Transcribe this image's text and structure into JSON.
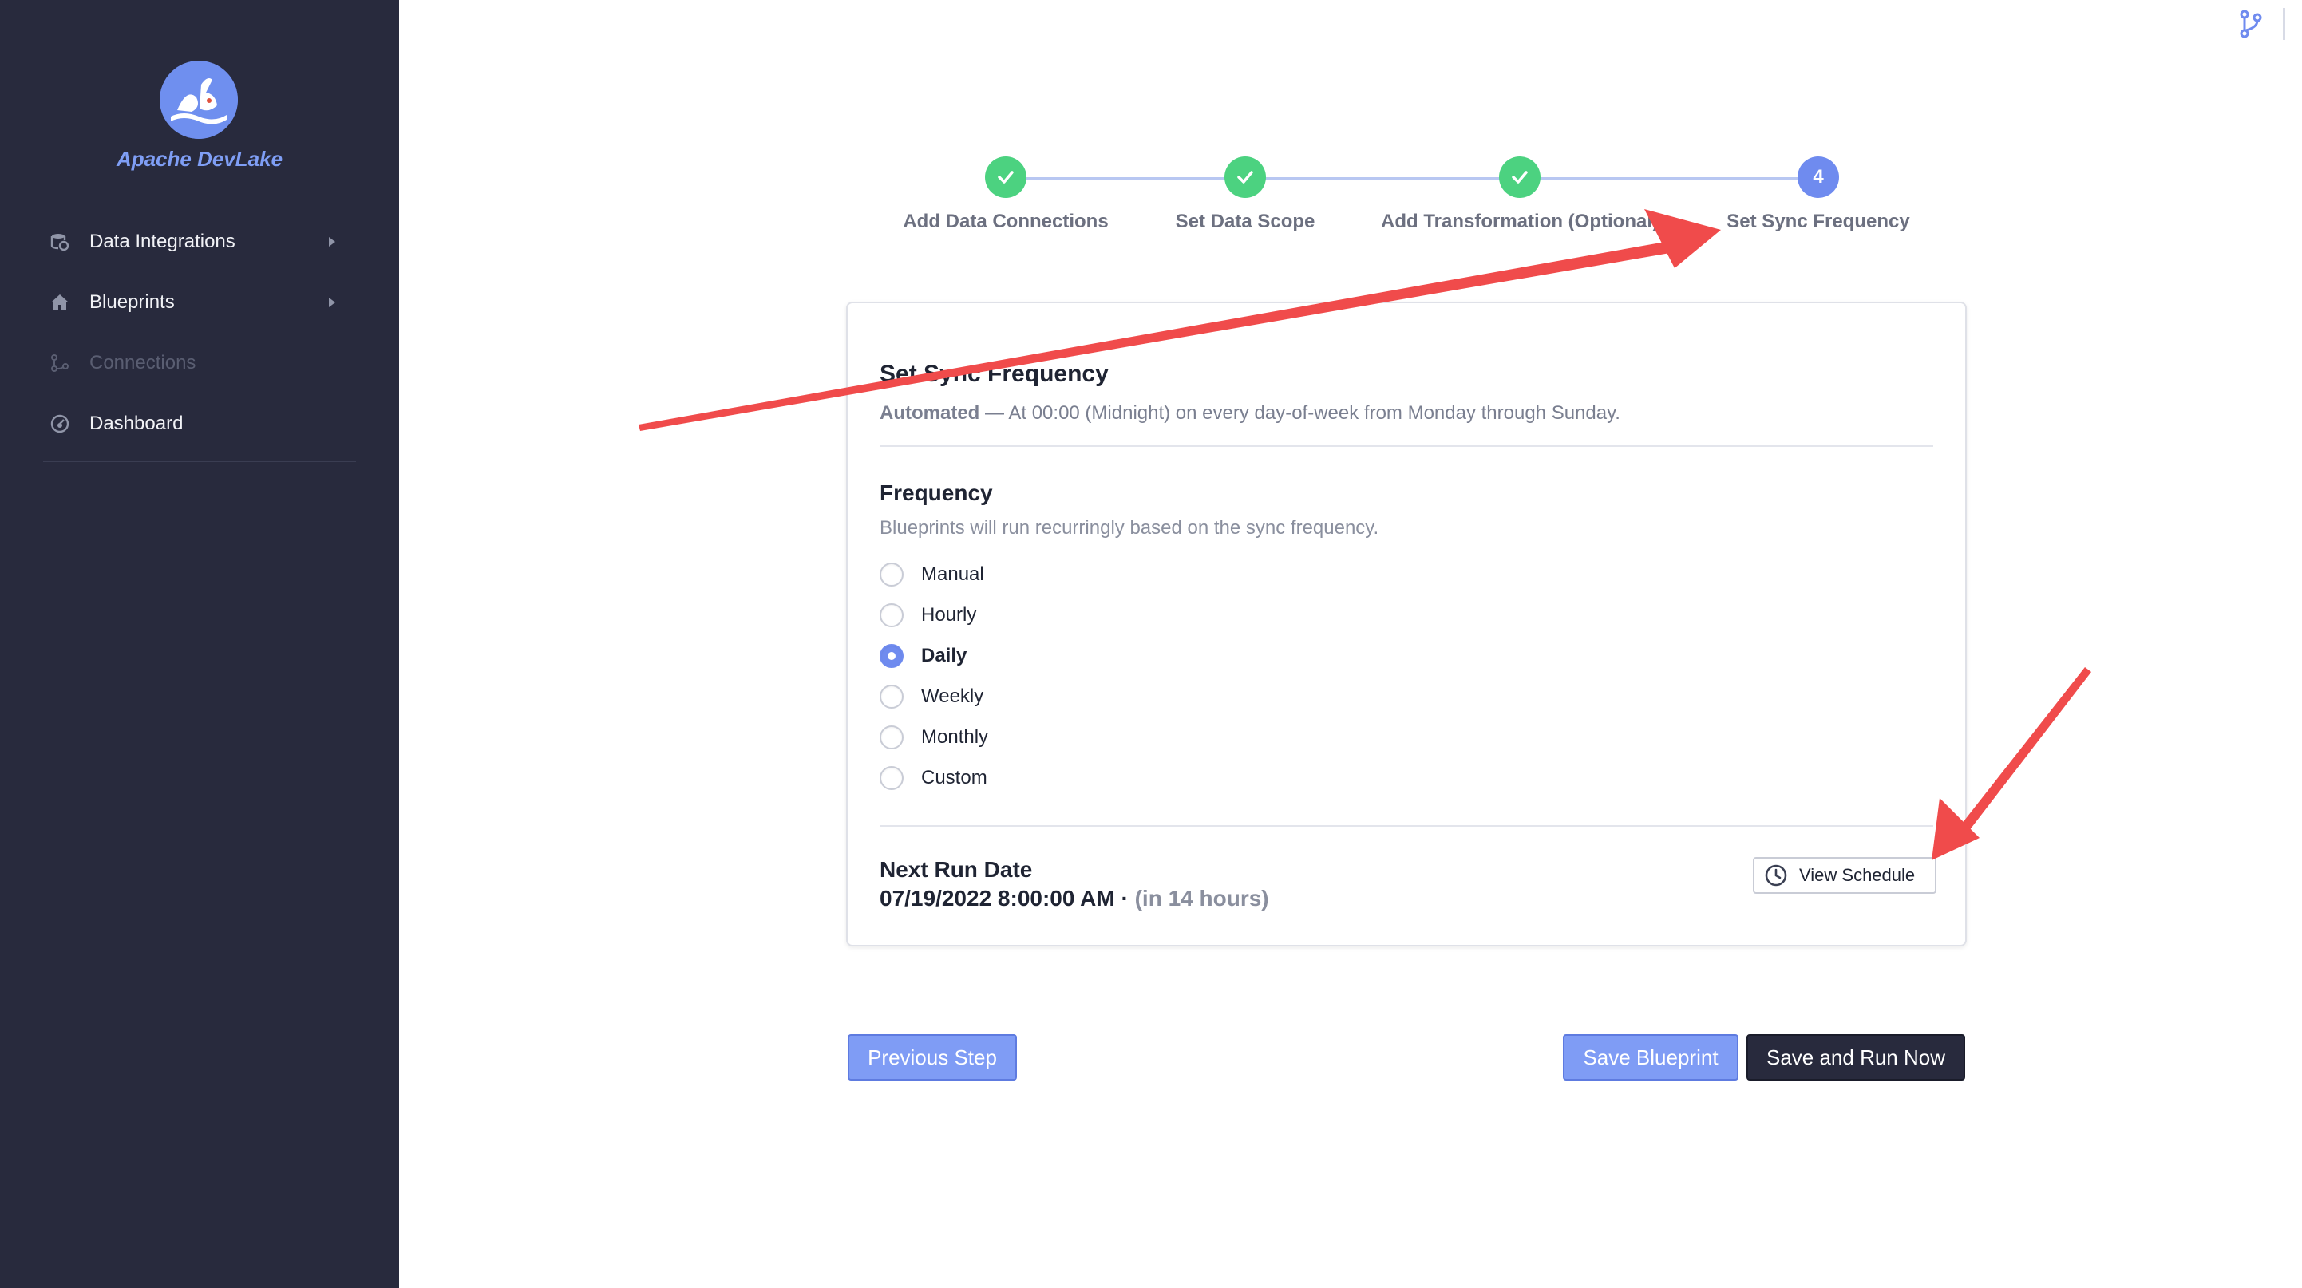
{
  "app": {
    "name": "Apache DevLake"
  },
  "sidebar": {
    "items": [
      {
        "label": "Data Integrations",
        "icon": "database-icon",
        "expandable": true,
        "disabled": false
      },
      {
        "label": "Blueprints",
        "icon": "home-icon",
        "expandable": true,
        "disabled": false
      },
      {
        "label": "Connections",
        "icon": "connections-icon",
        "expandable": false,
        "disabled": true
      },
      {
        "label": "Dashboard",
        "icon": "dashboard-icon",
        "expandable": false,
        "disabled": false
      }
    ]
  },
  "stepper": {
    "steps": [
      {
        "label": "Add Data Connections",
        "status": "done"
      },
      {
        "label": "Set Data Scope",
        "status": "done"
      },
      {
        "label": "Add Transformation (Optional)",
        "status": "done"
      },
      {
        "label": "Set Sync Frequency",
        "status": "active",
        "number": "4"
      }
    ]
  },
  "card": {
    "title": "Set Sync Frequency",
    "summary_mode": "Automated",
    "summary_text": " — At 00:00 (Midnight) on every day-of-week from Monday through Sunday.",
    "frequency_title": "Frequency",
    "frequency_desc": "Blueprints will run recurringly based on the sync frequency.",
    "options": [
      {
        "label": "Manual",
        "checked": false
      },
      {
        "label": "Hourly",
        "checked": false
      },
      {
        "label": "Daily",
        "checked": true
      },
      {
        "label": "Weekly",
        "checked": false
      },
      {
        "label": "Monthly",
        "checked": false
      },
      {
        "label": "Custom",
        "checked": false
      }
    ],
    "next_run_title": "Next Run Date",
    "next_run_date": "07/19/2022 8:00:00 AM · ",
    "next_run_relative": "(in 14 hours)",
    "view_schedule_label": "View Schedule"
  },
  "buttons": {
    "previous": "Previous Step",
    "save": "Save Blueprint",
    "save_run": "Save and Run Now"
  },
  "colors": {
    "sidebar_bg": "#282a3d",
    "accent": "#6f8bef",
    "success": "#4cd280",
    "annotation_arrow": "#f04b4b"
  }
}
